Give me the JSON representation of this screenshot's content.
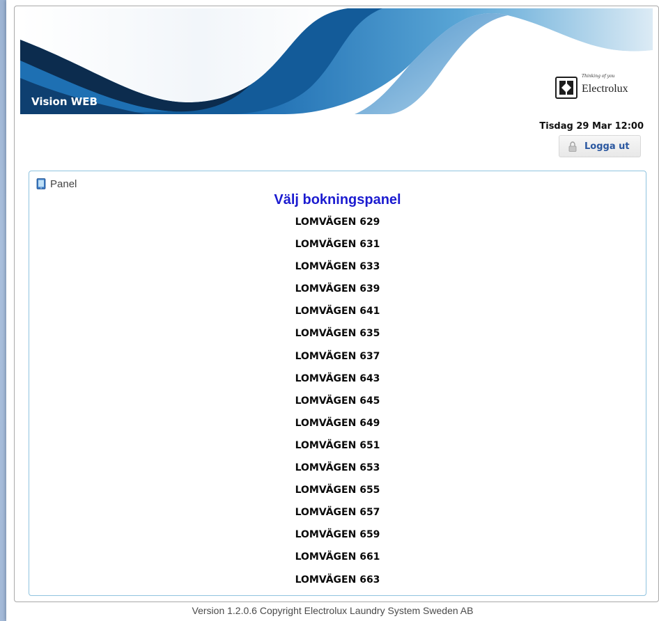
{
  "header": {
    "app_title": "Vision WEB",
    "brand_name": "Electrolux",
    "brand_tagline": "Thinking of you",
    "datetime": "Tisdag 29 Mar 12:00",
    "logout_label": "Logga ut"
  },
  "panel": {
    "title": "Panel",
    "heading": "Välj bokningspanel",
    "items": [
      "LOMVÄGEN 629",
      "LOMVÄGEN 631",
      "LOMVÄGEN 633",
      "LOMVÄGEN 639",
      "LOMVÄGEN 641",
      "LOMVÄGEN 635",
      "LOMVÄGEN 637",
      "LOMVÄGEN 643",
      "LOMVÄGEN 645",
      "LOMVÄGEN 649",
      "LOMVÄGEN 651",
      "LOMVÄGEN 653",
      "LOMVÄGEN 655",
      "LOMVÄGEN 657",
      "LOMVÄGEN 659",
      "LOMVÄGEN 661",
      "LOMVÄGEN 663"
    ]
  },
  "footer": {
    "version_text": "Version 1.2.0.6 Copyright Electrolux Laundry System Sweden AB"
  },
  "icons": {
    "panel": "tablet-icon",
    "logout": "padlock-icon",
    "brand": "electrolux-logo-icon"
  },
  "colors": {
    "heading": "#1b1bd0",
    "panel_border": "#8fc3df",
    "banner_blue": "#1f6aa8",
    "logout_text": "#2a57a0"
  }
}
